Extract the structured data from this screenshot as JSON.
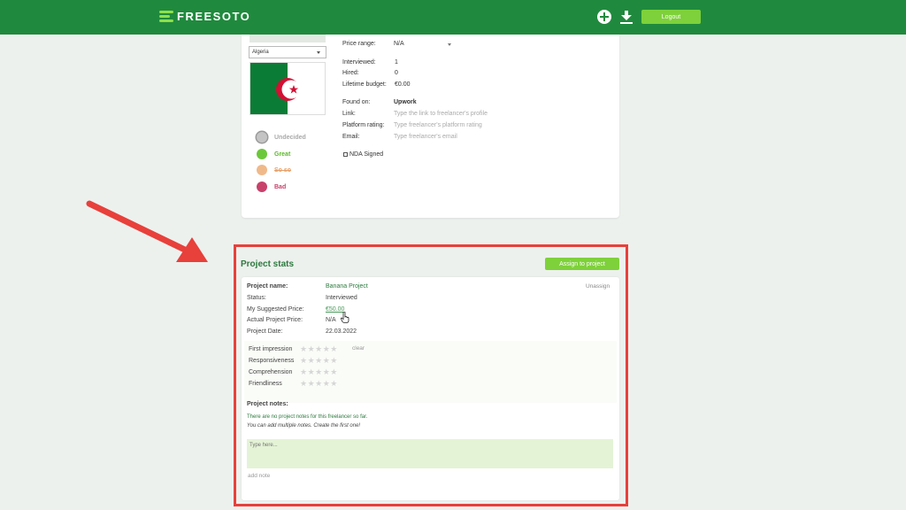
{
  "header": {
    "brand": "FREESOTO",
    "add_icon": "plus-circle-icon",
    "download_icon": "download-icon",
    "logout_label": "Logout",
    "colors": {
      "bar": "#1f8a3d",
      "accent": "#7ed13a"
    }
  },
  "profile": {
    "country": "Algeria",
    "status_options": [
      {
        "label": "Undecided",
        "color": "#bbbbbb"
      },
      {
        "label": "Great",
        "color": "#6cc83a"
      },
      {
        "label": "So so",
        "color": "#f0b98a"
      },
      {
        "label": "Bad",
        "color": "#c8416b"
      }
    ],
    "price_range_label": "Price range:",
    "price_range_value": "N/A",
    "interviewed_label": "Interviewed:",
    "interviewed_value": "1",
    "hired_label": "Hired:",
    "hired_value": "0",
    "lifetime_budget_label": "Lifetime budget:",
    "lifetime_budget_value": "€0.00",
    "found_on_label": "Found on:",
    "found_on_value": "Upwork",
    "link_label": "Link:",
    "link_placeholder": "Type the link to freelancer's profile",
    "platform_rating_label": "Platform rating:",
    "platform_rating_placeholder": "Type freelancer's platform rating",
    "email_label": "Email:",
    "email_placeholder": "Type freelancer's email",
    "nda_label": "NDA Signed"
  },
  "project_stats": {
    "title": "Project stats",
    "assign_label": "Assign to project",
    "unassign_label": "Unassign",
    "fields": [
      {
        "label": "Project name:",
        "value": "Banana Project"
      },
      {
        "label": "Status:",
        "value": "Interviewed"
      },
      {
        "label": "My Suggested Price:",
        "value": "€50.00"
      },
      {
        "label": "Actual Project Price:",
        "value": "N/A"
      },
      {
        "label": "Project Date:",
        "value": "22.03.2022"
      }
    ],
    "criteria": [
      {
        "label": "First impression",
        "stars": 0
      },
      {
        "label": "Responsiveness",
        "stars": 0
      },
      {
        "label": "Comprehension",
        "stars": 0
      },
      {
        "label": "Friendliness",
        "stars": 0
      }
    ],
    "clear_label": "clear",
    "notes_heading": "Project notes:",
    "notes_empty": "There are no project notes for this freelancer so far.",
    "notes_hint": "You can add multiple notes. Create the first one!",
    "note_placeholder": "Type here...",
    "add_note_label": "add note"
  }
}
